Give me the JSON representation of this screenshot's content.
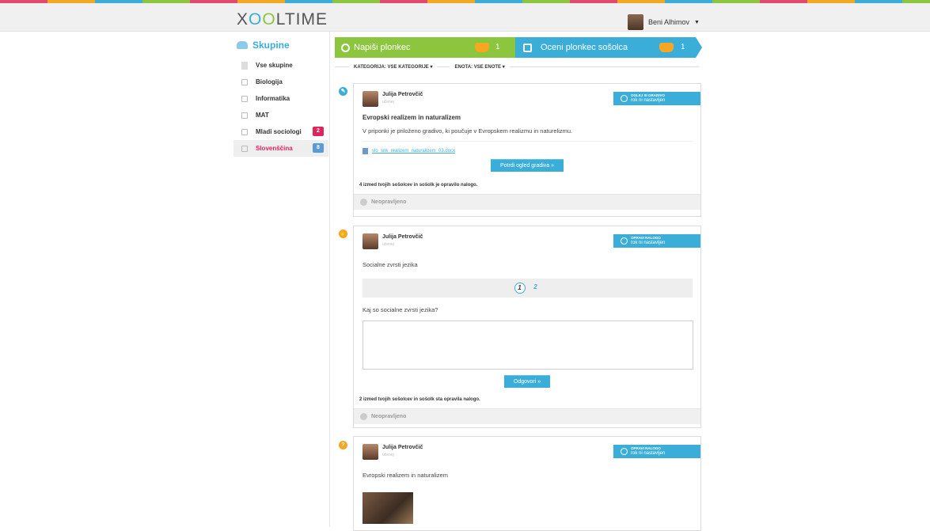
{
  "header": {
    "logo": "XOOLTIME",
    "user_name": "Beni Alhimov"
  },
  "sidebar": {
    "title": "Skupine",
    "items": [
      {
        "label": "Vse skupine"
      },
      {
        "label": "Biologija"
      },
      {
        "label": "Informatika"
      },
      {
        "label": "MAT"
      },
      {
        "label": "Mladi sociologi",
        "badge": "2"
      },
      {
        "label": "Slovenščina",
        "badge": "8"
      }
    ]
  },
  "banners": {
    "left_label": "Napiši plonkec",
    "left_count": "1",
    "right_label": "Oceni plonkec sošolca",
    "right_count": "1"
  },
  "filters": {
    "category": "KATEGORIJA: VSE KATEGORIJE",
    "unit": "ENOTA: VSE ENOTE"
  },
  "colors": {
    "green": "#8cc63f",
    "blue": "#3aaed8",
    "pink": "#e0245e",
    "orange": "#f5a623"
  },
  "cards": [
    {
      "author": "Julija Petrovčič",
      "role": "učenej",
      "status_top": "OGLEJ SI GRADIVO",
      "status_bottom": "rok ni nastavljen",
      "title": "Evropski realizem in naturalizem",
      "text": "V priponki je priloženo gradivo, ki poučuje v Evropskem realizmu in naturelizmu.",
      "file": "slo_snk_realizem_naturalizem_03.docx",
      "button": "Potrdi ogled gradiva »",
      "done_text": "4 izmed tvojih sošolcev in sošolk je opravilo nalogo.",
      "footer": "Neopravljeno"
    },
    {
      "author": "Julija Petrovčič",
      "role": "učenej",
      "status_top": "OPRAVI NALOGO",
      "status_bottom": "rok ni nastavljen",
      "text": "Socialne zvrsti jezika",
      "pages": [
        "1",
        "2"
      ],
      "question": "Kaj so socialne zvrsti jezika?",
      "button": "Odgovori »",
      "done_text": "2 izmed tvojih sošolcev in sošolk sta opravila nalogo.",
      "footer": "Neopravljeno"
    },
    {
      "author": "Julija Petrovčič",
      "role": "učenej",
      "status_top": "OPRAVI NALOGO",
      "status_bottom": "rok ni nastavljen",
      "text": "Evropski realizem in naturalizem"
    }
  ]
}
